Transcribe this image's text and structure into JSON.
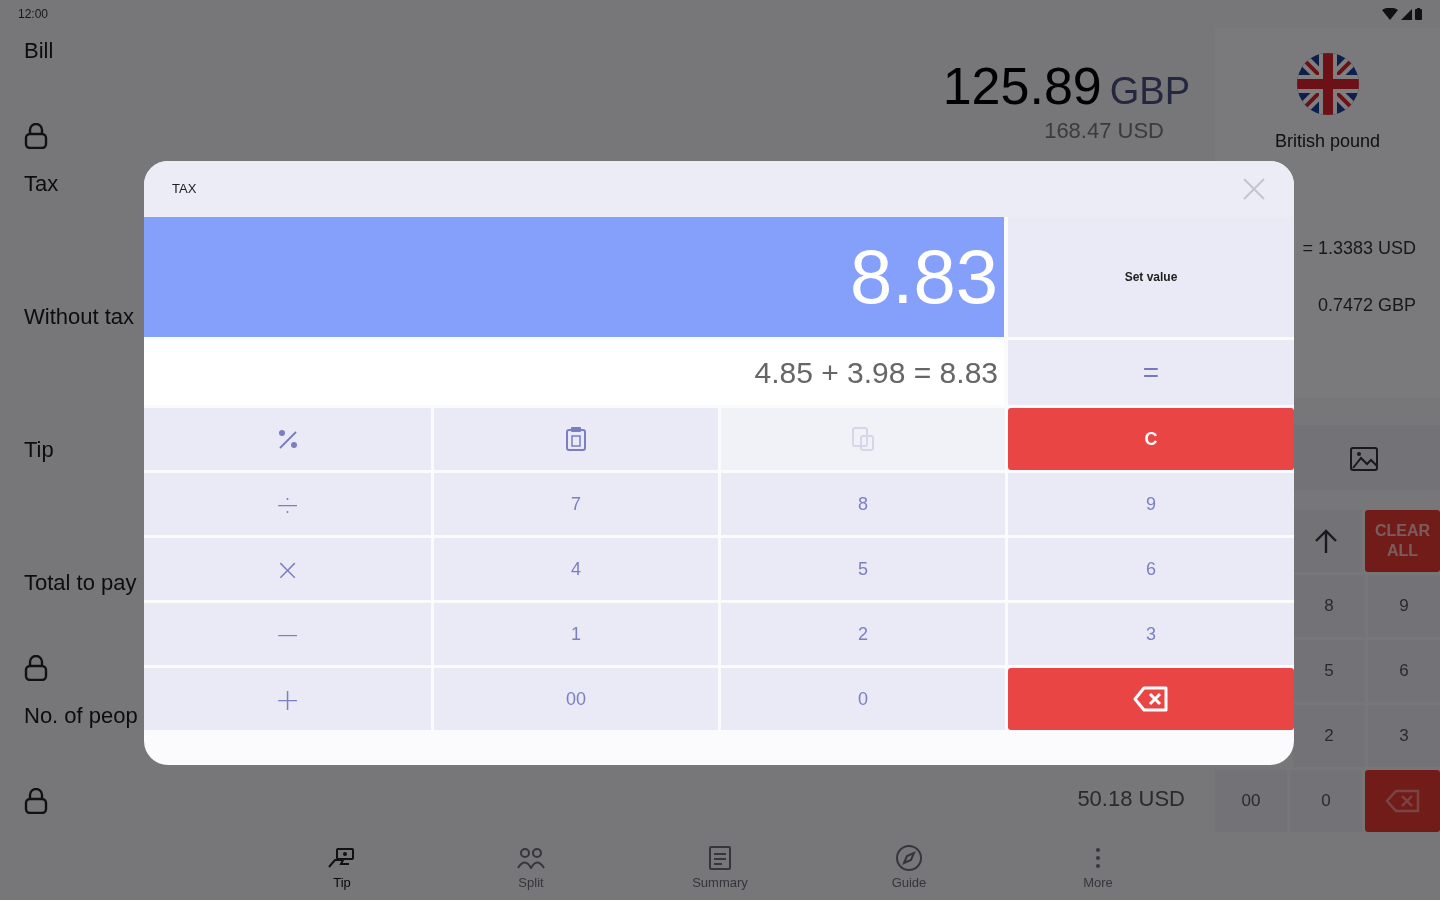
{
  "status_bar": {
    "time": "12:00"
  },
  "rows": [
    {
      "label": "Bill",
      "locked": true
    },
    {
      "label": "Tax",
      "locked": false
    },
    {
      "label": "Without tax",
      "locked": false
    },
    {
      "label": "Tip",
      "locked": false
    },
    {
      "label": "Total to pay",
      "locked": true
    },
    {
      "label": "No. of peop",
      "locked": true
    }
  ],
  "bill": {
    "amount": "125.89",
    "currency": "GBP",
    "converted": "168.47 USD"
  },
  "currency": {
    "name": "British pound",
    "rates": [
      "= 1.3383 USD",
      "0.7472 GBP"
    ]
  },
  "per_person": {
    "converted": "50.18 USD"
  },
  "keypad": [
    [
      {
        "kind": "image"
      }
    ],
    [
      {
        "kind": "up"
      },
      {
        "kind": "clear",
        "label": "CLEAR ALL"
      }
    ],
    [
      {
        "kind": "digit",
        "label": "8"
      },
      {
        "kind": "digit",
        "label": "9"
      }
    ],
    [
      {
        "kind": "digit",
        "label": "5"
      },
      {
        "kind": "digit",
        "label": "6"
      }
    ],
    [
      {
        "kind": "digit",
        "label": "2"
      },
      {
        "kind": "digit",
        "label": "3"
      }
    ],
    [
      {
        "kind": "digit",
        "label": "00"
      },
      {
        "kind": "digit",
        "label": "0"
      },
      {
        "kind": "backspace"
      }
    ]
  ],
  "nav": [
    {
      "kind": "tip",
      "label": "Tip",
      "selected": true
    },
    {
      "kind": "split",
      "label": "Split",
      "selected": false
    },
    {
      "kind": "summary",
      "label": "Summary",
      "selected": false
    },
    {
      "kind": "guide",
      "label": "Guide",
      "selected": false
    },
    {
      "kind": "more",
      "label": "More",
      "selected": false
    }
  ],
  "dialog": {
    "title": "TAX",
    "value": "8.83",
    "expression": "4.85 + 3.98 = 8.83",
    "set_label": "Set value",
    "equals_label": "=",
    "keys": [
      {
        "kind": "percent",
        "disabled": false
      },
      {
        "kind": "copy",
        "disabled": false
      },
      {
        "kind": "paste",
        "disabled": true
      },
      {
        "kind": "clear",
        "label": "C",
        "disabled": false
      },
      {
        "kind": "operator",
        "label": "÷",
        "disabled": false
      },
      {
        "kind": "digit",
        "label": "7",
        "disabled": false
      },
      {
        "kind": "digit",
        "label": "8",
        "disabled": false
      },
      {
        "kind": "digit",
        "label": "9",
        "disabled": false
      },
      {
        "kind": "operator",
        "label": "×",
        "disabled": false
      },
      {
        "kind": "digit",
        "label": "4",
        "disabled": false
      },
      {
        "kind": "digit",
        "label": "5",
        "disabled": false
      },
      {
        "kind": "digit",
        "label": "6",
        "disabled": false
      },
      {
        "kind": "operator",
        "label": "−",
        "disabled": false
      },
      {
        "kind": "digit",
        "label": "1",
        "disabled": false
      },
      {
        "kind": "digit",
        "label": "2",
        "disabled": false
      },
      {
        "kind": "digit",
        "label": "3",
        "disabled": false
      },
      {
        "kind": "operator",
        "label": "+",
        "disabled": false
      },
      {
        "kind": "digit",
        "label": "00",
        "disabled": false
      },
      {
        "kind": "digit",
        "label": "0",
        "disabled": false
      },
      {
        "kind": "backspace",
        "disabled": false
      }
    ]
  }
}
